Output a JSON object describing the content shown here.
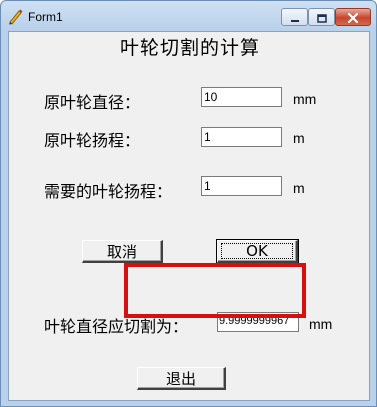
{
  "window": {
    "title": "Form1"
  },
  "titlebar": {
    "icon": "app-pen-icon",
    "minimize_icon": "minimize-icon",
    "maximize_icon": "maximize-icon",
    "close_icon": "close-icon"
  },
  "form": {
    "heading": "叶轮切割的计算",
    "fields": [
      {
        "label": "原叶轮直径：",
        "value": "10",
        "unit": "mm"
      },
      {
        "label": "原叶轮扬程：",
        "value": "1",
        "unit": "m"
      },
      {
        "label": "需要的叶轮扬程：",
        "value": "1",
        "unit": "m"
      }
    ],
    "cancel_label": "取消",
    "ok_label": "OK",
    "result": {
      "label": "叶轮直径应切割为：",
      "value": "9.9999999967",
      "unit": "mm"
    },
    "exit_label": "退出"
  },
  "colors": {
    "highlight": "#d60f0f",
    "client_bg": "#f0f0f0",
    "frame": "#b9d1ea"
  }
}
